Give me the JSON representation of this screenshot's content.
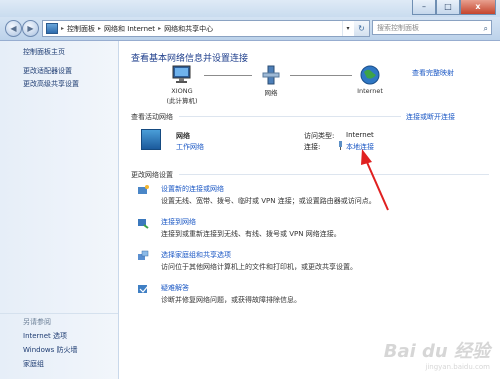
{
  "window": {
    "buttons": {
      "minimize": "–",
      "maximize": "□",
      "close": "x"
    }
  },
  "address_bar": {
    "back": "◀",
    "forward": "▶",
    "crumbs": [
      "控制面板",
      "网络和 Internet",
      "网络和共享中心"
    ],
    "separator": "▸",
    "dropdown": "▾",
    "refresh": "↻",
    "search_placeholder": "搜索控制面板"
  },
  "sidebar": {
    "items": [
      {
        "label": "控制面板主页"
      },
      {
        "label": "更改适配器设置"
      },
      {
        "label": "更改高级共享设置"
      }
    ],
    "see_also_heading": "另请参阅",
    "see_also": [
      {
        "label": "Internet 选项"
      },
      {
        "label": "Windows 防火墙"
      },
      {
        "label": "家庭组"
      }
    ]
  },
  "main": {
    "title": "查看基本网络信息并设置连接",
    "full_map_link": "查看完整映射",
    "map_nodes": [
      {
        "label": "XIONG",
        "sublabel": "(此计算机)"
      },
      {
        "label": "网络"
      },
      {
        "label": "Internet"
      }
    ],
    "active_networks_heading": "查看活动网络",
    "connect_disconnect_link": "连接或断开连接",
    "network": {
      "name": "网络",
      "type_link": "工作网络",
      "access_type_label": "访问类型:",
      "access_type_value": "Internet",
      "connection_label": "连接:",
      "connection_link": "本地连接"
    },
    "change_settings_heading": "更改网络设置",
    "tasks": [
      {
        "title": "设置新的连接或网络",
        "desc": "设置无线、宽带、拨号、临时或 VPN 连接；或设置路由器或访问点。"
      },
      {
        "title": "连接到网络",
        "desc": "连接到或重新连接到无线、有线、拨号或 VPN 网络连接。"
      },
      {
        "title": "选择家庭组和共享选项",
        "desc": "访问位于其他网络计算机上的文件和打印机，或更改共享设置。"
      },
      {
        "title": "疑难解答",
        "desc": "诊断并修复网络问题，或获得故障排除信息。"
      }
    ]
  },
  "watermark": {
    "text": "Bai du 经验",
    "sub": "jingyan.baidu.com"
  },
  "colors": {
    "link": "#1a57c4",
    "title": "#1f3f8c",
    "arrow": "#e02020"
  }
}
